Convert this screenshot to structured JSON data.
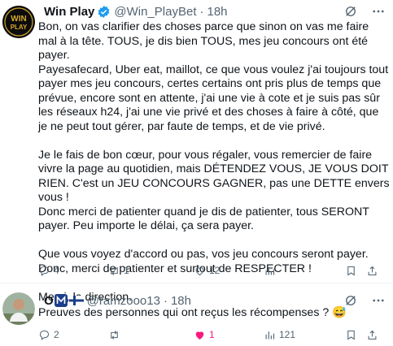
{
  "tweet1": {
    "name": "Win Play",
    "handle": "@Win_PlayBet",
    "separator": "·",
    "time": "18h",
    "avatar_text_top": "WIN",
    "avatar_text_bottom": "PLAY",
    "text": "Bon, on vas clarifier des choses parce que sinon on vas me faire mal à la tête. TOUS, je dis bien TOUS, mes jeu concours ont été payer.\nPayesafecard, Uber eat, maillot, ce que vous voulez j'ai toujours tout payer mes jeu concours, certes certains ont pris plus de temps que prévue, encore sont en attente, j'ai une vie à cote et je suis pas sûr les réseaux h24, j'ai une vie privé et des choses à faire à côté, que je ne peut tout gérer, par faute de temps, et de vie privé.\n\nJe le fais de bon cœur, pour vous régaler, vous remercier de faire vivre la page au quotidien, mais DÉTENDEZ VOUS, JE VOUS DOIT RIEN. C'est un JEU CONCOURS GAGNER, pas une DETTE envers vous !\nDonc merci de patienter quand je dis de patienter, tous SERONT payer. Peu importe le délai, ça sera payer.\n\nQue vous voyez d'accord ou pas, vos jeu concours seront payer. Donc, merci de patienter et surtout de RESPECTER !\n\nMerci, la direction.",
    "replies": "4",
    "reposts": "1",
    "likes": "12",
    "views": "",
    "bookmarks": ""
  },
  "tweet2": {
    "name": "O",
    "handle": "@ramzooo13",
    "separator": "·",
    "time": "18h",
    "text": "Preuves des personnes qui ont reçus les récompenses ? 😅",
    "replies": "2",
    "reposts": "",
    "likes": "1",
    "views": "121",
    "liked_color": "#f91880"
  },
  "colors": {
    "muted": "#536471",
    "accent": "#1d9bf0",
    "gold": "#d4a72c"
  }
}
